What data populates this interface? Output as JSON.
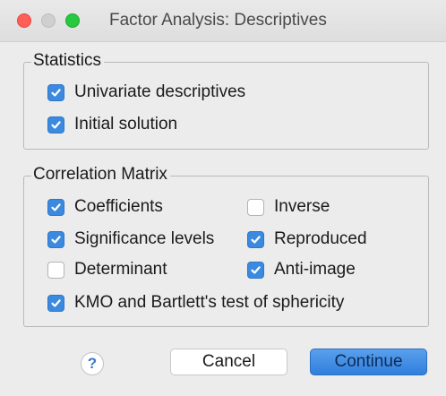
{
  "window": {
    "title": "Factor Analysis: Descriptives"
  },
  "statistics": {
    "legend": "Statistics",
    "items": [
      {
        "label": "Univariate descriptives",
        "checked": true
      },
      {
        "label": "Initial solution",
        "checked": true
      }
    ]
  },
  "correlation_matrix": {
    "legend": "Correlation Matrix",
    "items": [
      {
        "label": "Coefficients",
        "checked": true
      },
      {
        "label": "Inverse",
        "checked": false
      },
      {
        "label": "Significance levels",
        "checked": true
      },
      {
        "label": "Reproduced",
        "checked": true
      },
      {
        "label": "Determinant",
        "checked": false
      },
      {
        "label": "Anti-image",
        "checked": true
      },
      {
        "label": "KMO and Bartlett's test of sphericity",
        "checked": true
      }
    ]
  },
  "buttons": {
    "help": "?",
    "cancel": "Cancel",
    "continue": "Continue"
  },
  "colors": {
    "checkbox_checked": "#3b8ae0",
    "continue_button": "#2f7fdc",
    "close_light": "#ff5f57",
    "zoom_light": "#28c840"
  },
  "icons": {
    "checkmark": "checkmark-icon",
    "help": "question-mark-icon"
  }
}
